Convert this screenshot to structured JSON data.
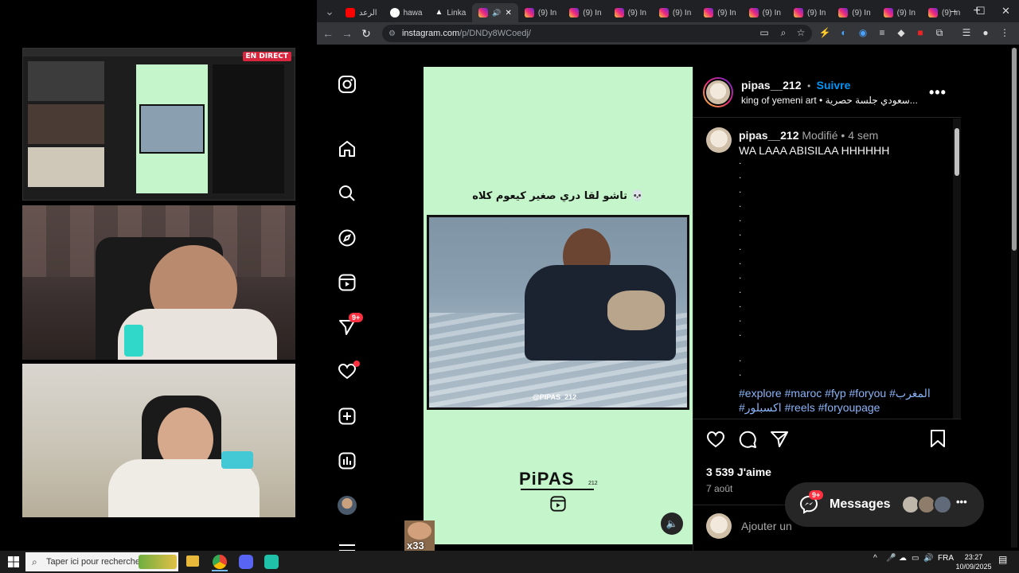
{
  "stream": {
    "live_badge": "EN DIRECT"
  },
  "browser": {
    "tabs": [
      {
        "label": "الرعد",
        "icon": "youtube-icon"
      },
      {
        "label": "hawa",
        "icon": "google-icon"
      },
      {
        "label": "Linka",
        "icon": "drive-icon"
      },
      {
        "label": "",
        "icon": "instagram-icon",
        "active": true
      },
      {
        "label": "(9) In",
        "icon": "instagram-icon"
      },
      {
        "label": "(9) In",
        "icon": "instagram-icon"
      },
      {
        "label": "(9) In",
        "icon": "instagram-icon"
      },
      {
        "label": "(9) In",
        "icon": "instagram-icon"
      },
      {
        "label": "(9) In",
        "icon": "instagram-icon"
      },
      {
        "label": "(9) In",
        "icon": "instagram-icon"
      },
      {
        "label": "(9) In",
        "icon": "instagram-icon"
      },
      {
        "label": "(9) In",
        "icon": "instagram-icon"
      },
      {
        "label": "(9) In",
        "icon": "instagram-icon"
      },
      {
        "label": "(9) In",
        "icon": "instagram-icon"
      }
    ],
    "url_host": "instagram.com",
    "url_path": "/p/DNDy8WCoedj/"
  },
  "instagram": {
    "nav": [
      {
        "name": "instagram-logo-icon"
      },
      {
        "name": "home-icon"
      },
      {
        "name": "search-icon"
      },
      {
        "name": "explore-icon"
      },
      {
        "name": "reels-icon"
      },
      {
        "name": "messages-icon",
        "badge": "9+"
      },
      {
        "name": "notifications-icon"
      },
      {
        "name": "create-icon"
      },
      {
        "name": "dashboard-icon"
      },
      {
        "name": "profile-avatar"
      },
      {
        "name": "more-menu-icon"
      }
    ],
    "post": {
      "media_caption": "تاشو لقا دري صغير كيعوم كلاه 💀",
      "watermark": "@PIPAS_212",
      "brand": "PiPAS",
      "brand_sub": "212",
      "header": {
        "username": "pipas__212",
        "separator": "•",
        "follow": "Suivre",
        "subtitle": "king of yemeni art • سعودي جلسة حصرية..."
      },
      "caption": {
        "username": "pipas__212",
        "edited": "Modifié",
        "separator": "•",
        "time": "4 sem",
        "text": "WA LAAA ABISILAA HHHHHH",
        "dots": ".",
        "hashtags_line1": "#explore #maroc #fyp #foryou #المغرب",
        "hashtags_line2": "#اكسبلور #reels #foryoupage"
      },
      "likes": "3 539 J'aime",
      "date": "7 août",
      "comment_placeholder": "Ajouter un"
    },
    "messages_pill": {
      "label": "Messages",
      "badge": "9+"
    },
    "reel_overlay_label": "x33"
  },
  "taskbar": {
    "search_placeholder": "Taper ici pour rechercher",
    "language": "FRA",
    "time": "23:27",
    "date": "10/09/2025"
  }
}
